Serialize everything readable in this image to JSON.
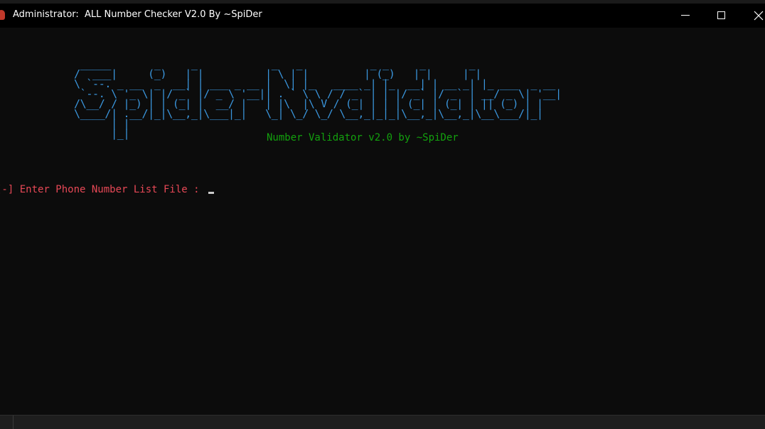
{
  "window": {
    "title": "Administrator:  ALL Number Checker V2.0 By ~SpiDer",
    "icon": "spider-app-icon",
    "controls": [
      "minimize-icon",
      "maximize-icon",
      "close-icon"
    ]
  },
  "console": {
    "banner_text": "SpiderNvalidator",
    "banner_ascii": " _____       _     _            _   _           _ _     _       _             \n/  ___|     (_)   | |          | \\ | |         | (_)   | |     | |            \n\\ `--. _ __  _  __| | ___ _ __ |  \\| |_   ____ _| |_  __| | __ _| |_ ___  _ __ \n `--. \\ '_ \\| |/ _` |/ _ \\ '__|| . ` \\ \\ / / _` | | |/ _` |/ _` | __/ _ \\| '__|\n/\\__/ / |_) | | (_| |  __/ |   | |\\  |\\ V / (_| | | | (_| | (_| | || (_) | |   \n\\____/| .__/|_|\\__,_|\\___|_|   \\_| \\_/ \\_/ \\__,_|_|_|\\__,_|\\__,_|\\__\\___/|_|   \n      | |                                                                     \n      |_|                                                                     ",
    "subtitle": "Number Validator v2.0 by ~SpiDer",
    "prompt": "[-] Enter Phone Number List File : ",
    "input_value": ""
  },
  "colors": {
    "background": "#0c0c0c",
    "titlebar": "#000000",
    "banner": "#3a96dd",
    "subtitle": "#13a10e",
    "prompt": "#e74856",
    "cursor": "#cccccc"
  }
}
